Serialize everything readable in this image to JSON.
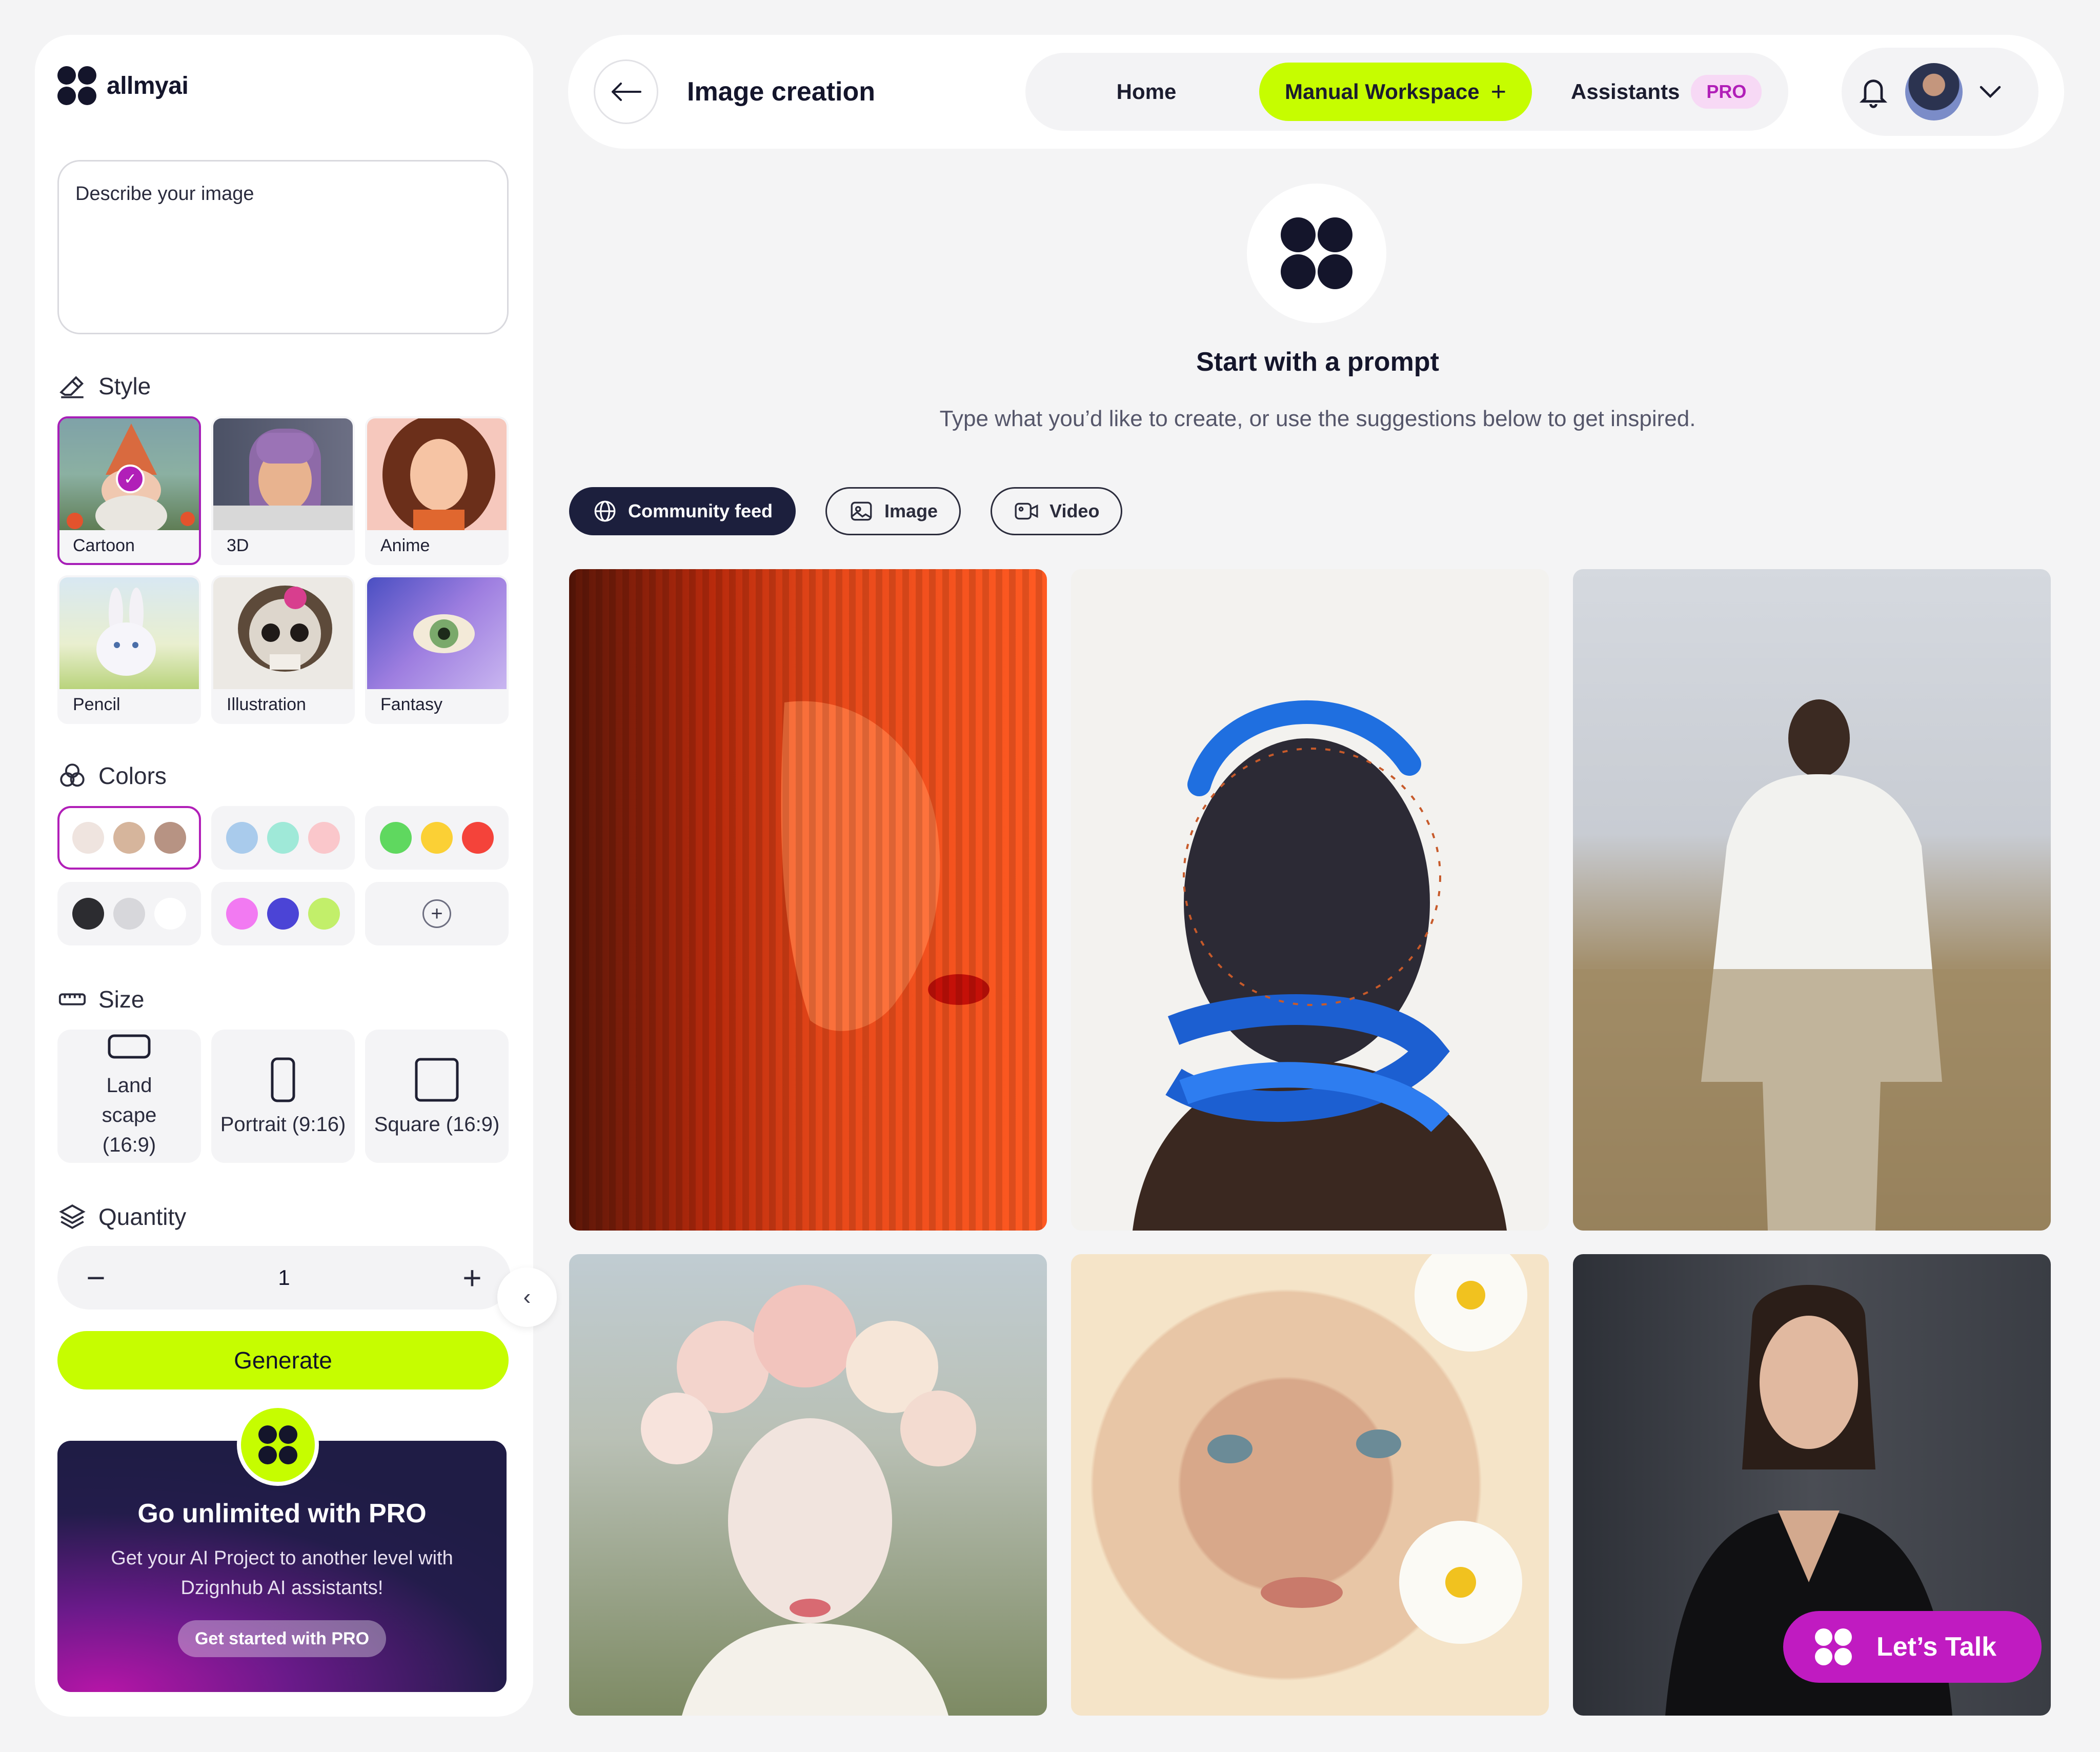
{
  "brand": {
    "name": "allmyai"
  },
  "sidebar": {
    "prompt_placeholder": "Describe your image",
    "style_title": "Style",
    "styles": [
      {
        "label": "Cartoon",
        "selected": true
      },
      {
        "label": "3D",
        "selected": false
      },
      {
        "label": "Anime",
        "selected": false
      },
      {
        "label": "Pencil",
        "selected": false
      },
      {
        "label": "Illustration",
        "selected": false
      },
      {
        "label": "Fantasy",
        "selected": false
      }
    ],
    "colors_title": "Colors",
    "color_sets": [
      [
        "#efe4df",
        "#d6b59c",
        "#b79383"
      ],
      [
        "#a9cbec",
        "#9fe9d8",
        "#fac7cb"
      ],
      [
        "#5fd85f",
        "#fbd035",
        "#f4433a"
      ],
      [
        "#2c2c30",
        "#d7d7db",
        "#ffffff"
      ],
      [
        "#f27af2",
        "#4b44d6",
        "#c2ef6a"
      ]
    ],
    "add_color_icon": "plus-icon",
    "size_title": "Size",
    "sizes": [
      {
        "label": "Land scape (16:9)",
        "icon": "landscape-icon"
      },
      {
        "label": "Portrait (9:16)",
        "icon": "portrait-icon"
      },
      {
        "label": "Square (16:9)",
        "icon": "square-icon"
      }
    ],
    "quantity_title": "Quantity",
    "quantity_value": "1",
    "generate_label": "Generate",
    "pro_card": {
      "title": "Go unlimited with PRO",
      "text": "Get your AI Project to another level with Dzignhub AI assistants!",
      "button_label": "Get started with PRO"
    }
  },
  "topbar": {
    "title": "Image creation",
    "nav": {
      "home": "Home",
      "manual": "Manual Workspace",
      "assistants": "Assistants",
      "pro_tag": "PRO"
    }
  },
  "main": {
    "hero_title": "Start with a prompt",
    "hero_subtitle": "Type what you’d like to create, or use the suggestions below to get inspired.",
    "filters": [
      {
        "label": "Community feed",
        "icon": "globe-icon",
        "active": true
      },
      {
        "label": "Image",
        "icon": "image-icon",
        "active": false
      },
      {
        "label": "Video",
        "icon": "video-icon",
        "active": false
      }
    ]
  },
  "chat": {
    "label": "Let’s Talk"
  },
  "colors": {
    "accent": "#c6fd00",
    "brand_purple": "#b11fb8",
    "dark": "#14152b"
  }
}
